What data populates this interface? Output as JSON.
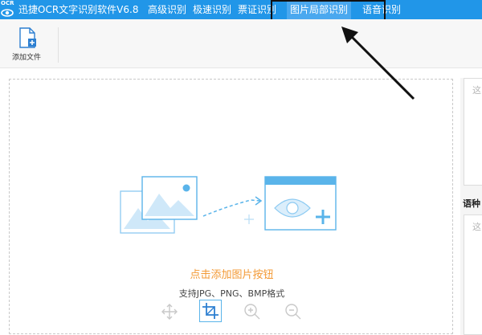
{
  "app": {
    "logo_text": "OCR",
    "title": "迅捷OCR文字识别软件V6.8"
  },
  "menu": {
    "items": [
      {
        "label": "高级识别"
      },
      {
        "label": "极速识别"
      },
      {
        "label": "票证识别"
      },
      {
        "label": "图片局部识别",
        "active": true
      },
      {
        "label": "语音识别"
      }
    ]
  },
  "toolbar": {
    "add_file_label": "添加文件"
  },
  "dropzone": {
    "main_hint": "点击添加图片按钮",
    "sub_hint": "支持JPG、PNG、BMP格式",
    "tools": [
      "move-icon",
      "crop-icon",
      "zoom-in-icon",
      "zoom-out-icon"
    ]
  },
  "right_panel": {
    "top_placeholder": "这",
    "language_label": "语种",
    "bottom_placeholder": "这"
  },
  "colors": {
    "menubar": "#2196e8",
    "accent_orange": "#f39a36",
    "icon_blue": "#5ab4ea",
    "annotation": "#111111"
  }
}
